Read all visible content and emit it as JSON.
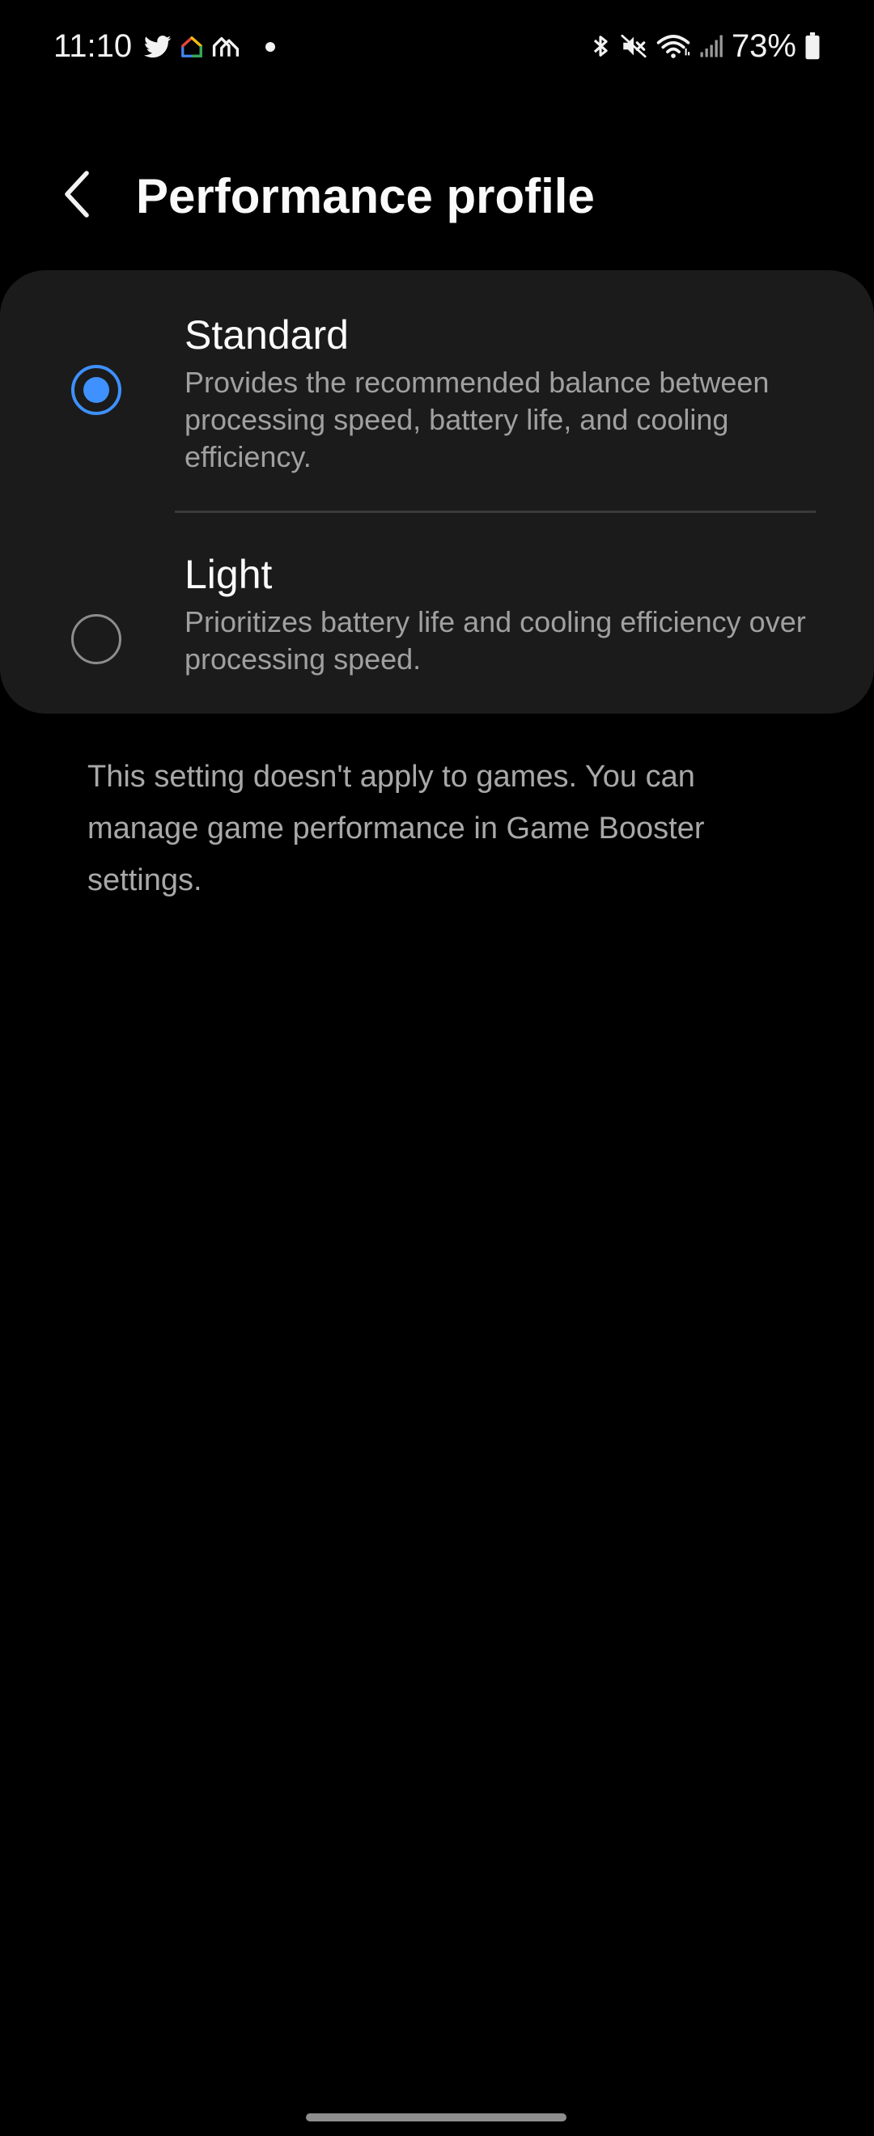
{
  "status_bar": {
    "time": "11:10",
    "battery": "73%",
    "left_icons": [
      "twitter-icon",
      "smart-home-icon",
      "home-app-icon",
      "notification-dot-icon"
    ],
    "right_icons": [
      "bluetooth-icon",
      "mute-icon",
      "wifi-icon",
      "signal-icon",
      "battery-icon"
    ]
  },
  "header": {
    "title": "Performance profile",
    "back_icon": "chevron-left-icon"
  },
  "options": [
    {
      "title": "Standard",
      "description": "Provides the recommended balance between processing speed, battery life, and cooling efficiency.",
      "selected": true
    },
    {
      "title": "Light",
      "description": "Prioritizes battery life and cooling efficiency over processing speed.",
      "selected": false
    }
  ],
  "note": "This setting doesn't apply to games. You can manage game performance in Game Booster settings.",
  "colors": {
    "accent": "#3e91ff",
    "card_background": "#1b1b1b",
    "background": "#000000"
  }
}
